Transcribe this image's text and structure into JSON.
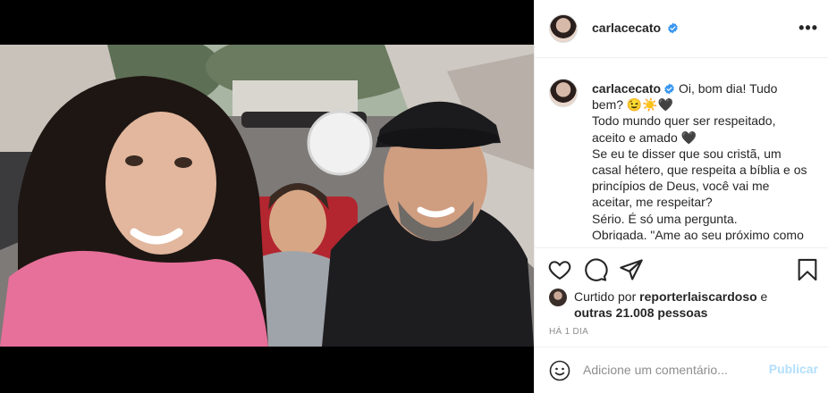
{
  "post": {
    "username": "carlacecato",
    "caption_lines": [
      "Oi, bom dia! Tudo",
      "bem? 😉☀️🖤",
      "Todo mundo quer ser respeitado,",
      "aceito e amado 🖤",
      "Se eu te disser que sou cristã, um",
      "casal hétero, que respeita a bíblia e os",
      "princípios de Deus, você vai me",
      "aceitar, me respeitar?",
      "Sério. É só uma pergunta.",
      "Obrigada. \"Ame ao seu próximo como"
    ],
    "liked_by_prefix": "Curtido por",
    "liked_by_user": "reporterlaiscardoso",
    "liked_and": "e",
    "liked_others": "outras 21.008 pessoas",
    "timestamp": "HÁ 1 DIA",
    "comment_placeholder": "Adicione um comentário...",
    "post_label": "Publicar"
  },
  "icons": {
    "more": "more-options-icon",
    "verified": "verified-badge-icon",
    "like": "heart-icon",
    "comment": "comment-icon",
    "share": "share-icon",
    "save": "bookmark-icon",
    "emoji": "emoji-icon"
  },
  "colors": {
    "verified": "#3897f0",
    "post_disabled": "#b2dffc",
    "timestamp": "#8e8e8e"
  }
}
